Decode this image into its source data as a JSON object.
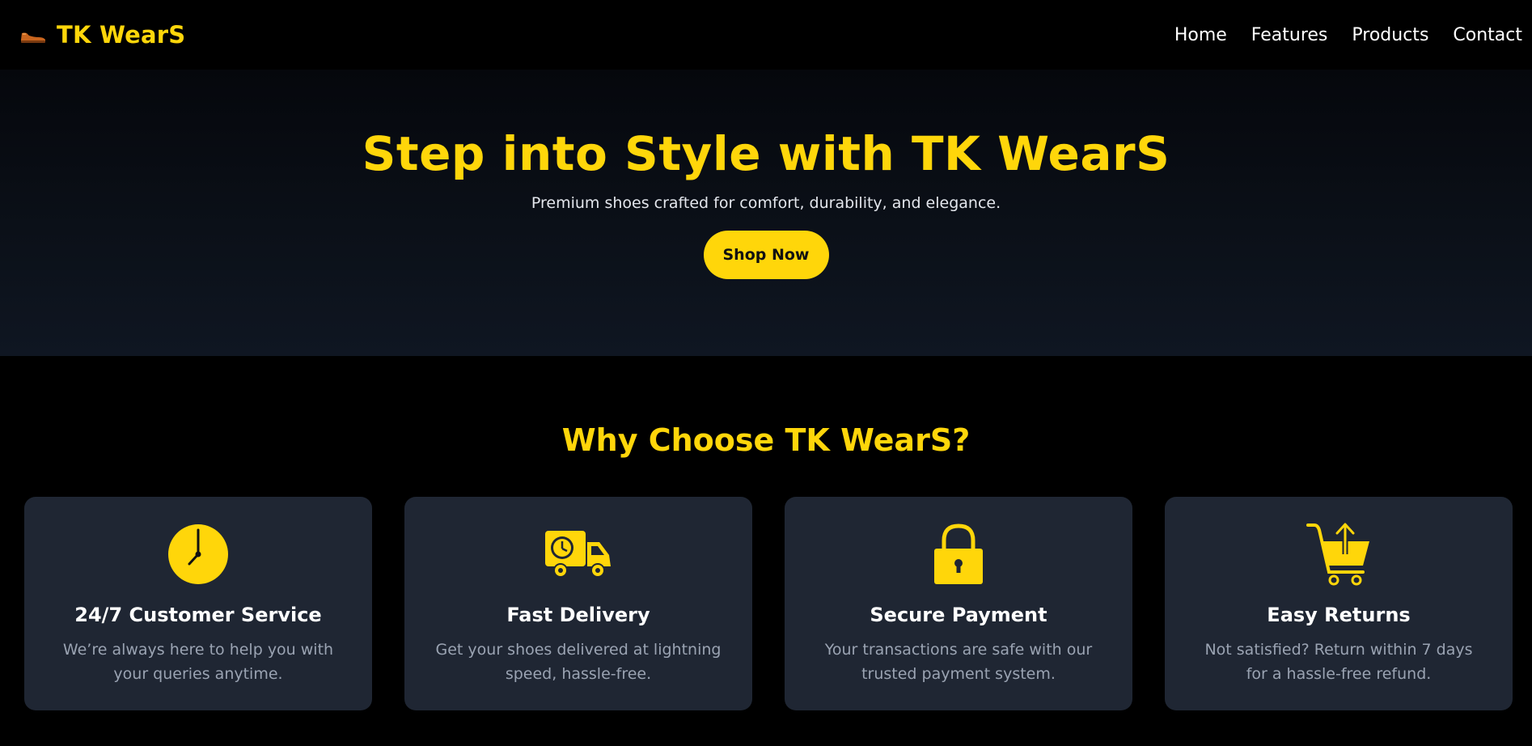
{
  "nav": {
    "brand": "TK WearS",
    "brand_icon": "shoe-icon",
    "links": [
      "Home",
      "Features",
      "Products",
      "Contact"
    ]
  },
  "hero": {
    "title": "Step into Style with TK WearS",
    "subtitle": "Premium shoes crafted for comfort, durability, and elegance.",
    "cta": "Shop Now"
  },
  "features": {
    "title": "Why Choose TK WearS?",
    "cards": [
      {
        "icon": "clock-icon",
        "title": "24/7 Customer Service",
        "desc": "We’re always here to help you with your queries anytime."
      },
      {
        "icon": "delivery-truck-icon",
        "title": "Fast Delivery",
        "desc": "Get your shoes delivered at lightning speed, hassle-free."
      },
      {
        "icon": "lock-icon",
        "title": "Secure Payment",
        "desc": "Your transactions are safe with our trusted payment system."
      },
      {
        "icon": "cart-return-icon",
        "title": "Easy Returns",
        "desc": "Not satisfied? Return within 7 days for a hassle-free refund."
      }
    ]
  },
  "colors": {
    "accent": "#FFD60A",
    "card_bg": "#1F2633",
    "background": "#000000"
  }
}
